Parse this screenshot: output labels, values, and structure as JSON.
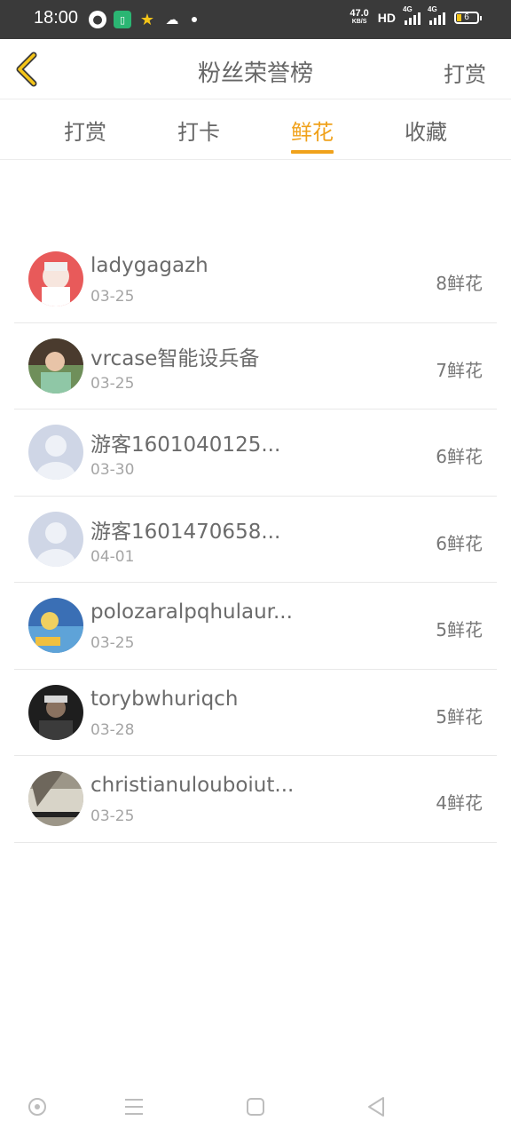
{
  "status_bar": {
    "time": "18:00",
    "net_speed": "47.0",
    "net_unit": "KB/S",
    "hd": "HD",
    "signal1": "4G",
    "signal2": "4G",
    "battery": "6"
  },
  "header": {
    "title": "粉丝荣誉榜",
    "action": "打赏"
  },
  "tabs": [
    {
      "label": "打赏",
      "active": false
    },
    {
      "label": "打卡",
      "active": false
    },
    {
      "label": "鲜花",
      "active": true
    },
    {
      "label": "收藏",
      "active": false
    }
  ],
  "accent_color": "#f0a21c",
  "rows": [
    {
      "name": "ladygagazh",
      "date": "03-25",
      "count": "8鲜花"
    },
    {
      "name": "vrcase智能设兵备",
      "date": "03-25",
      "count": "7鲜花"
    },
    {
      "name": "游客1601040125...",
      "date": "03-30",
      "count": "6鲜花"
    },
    {
      "name": "游客1601470658...",
      "date": "04-01",
      "count": "6鲜花"
    },
    {
      "name": "polozaralpqhulaur...",
      "date": "03-25",
      "count": "5鲜花"
    },
    {
      "name": "torybwhuriqch",
      "date": "03-28",
      "count": "5鲜花"
    },
    {
      "name": "christianulouboiut...",
      "date": "03-25",
      "count": "4鲜花"
    }
  ],
  "icons": {
    "back": "chevron-left-icon",
    "nav": [
      "home-circle-icon",
      "menu-icon",
      "square-icon",
      "back-triangle-icon"
    ]
  }
}
